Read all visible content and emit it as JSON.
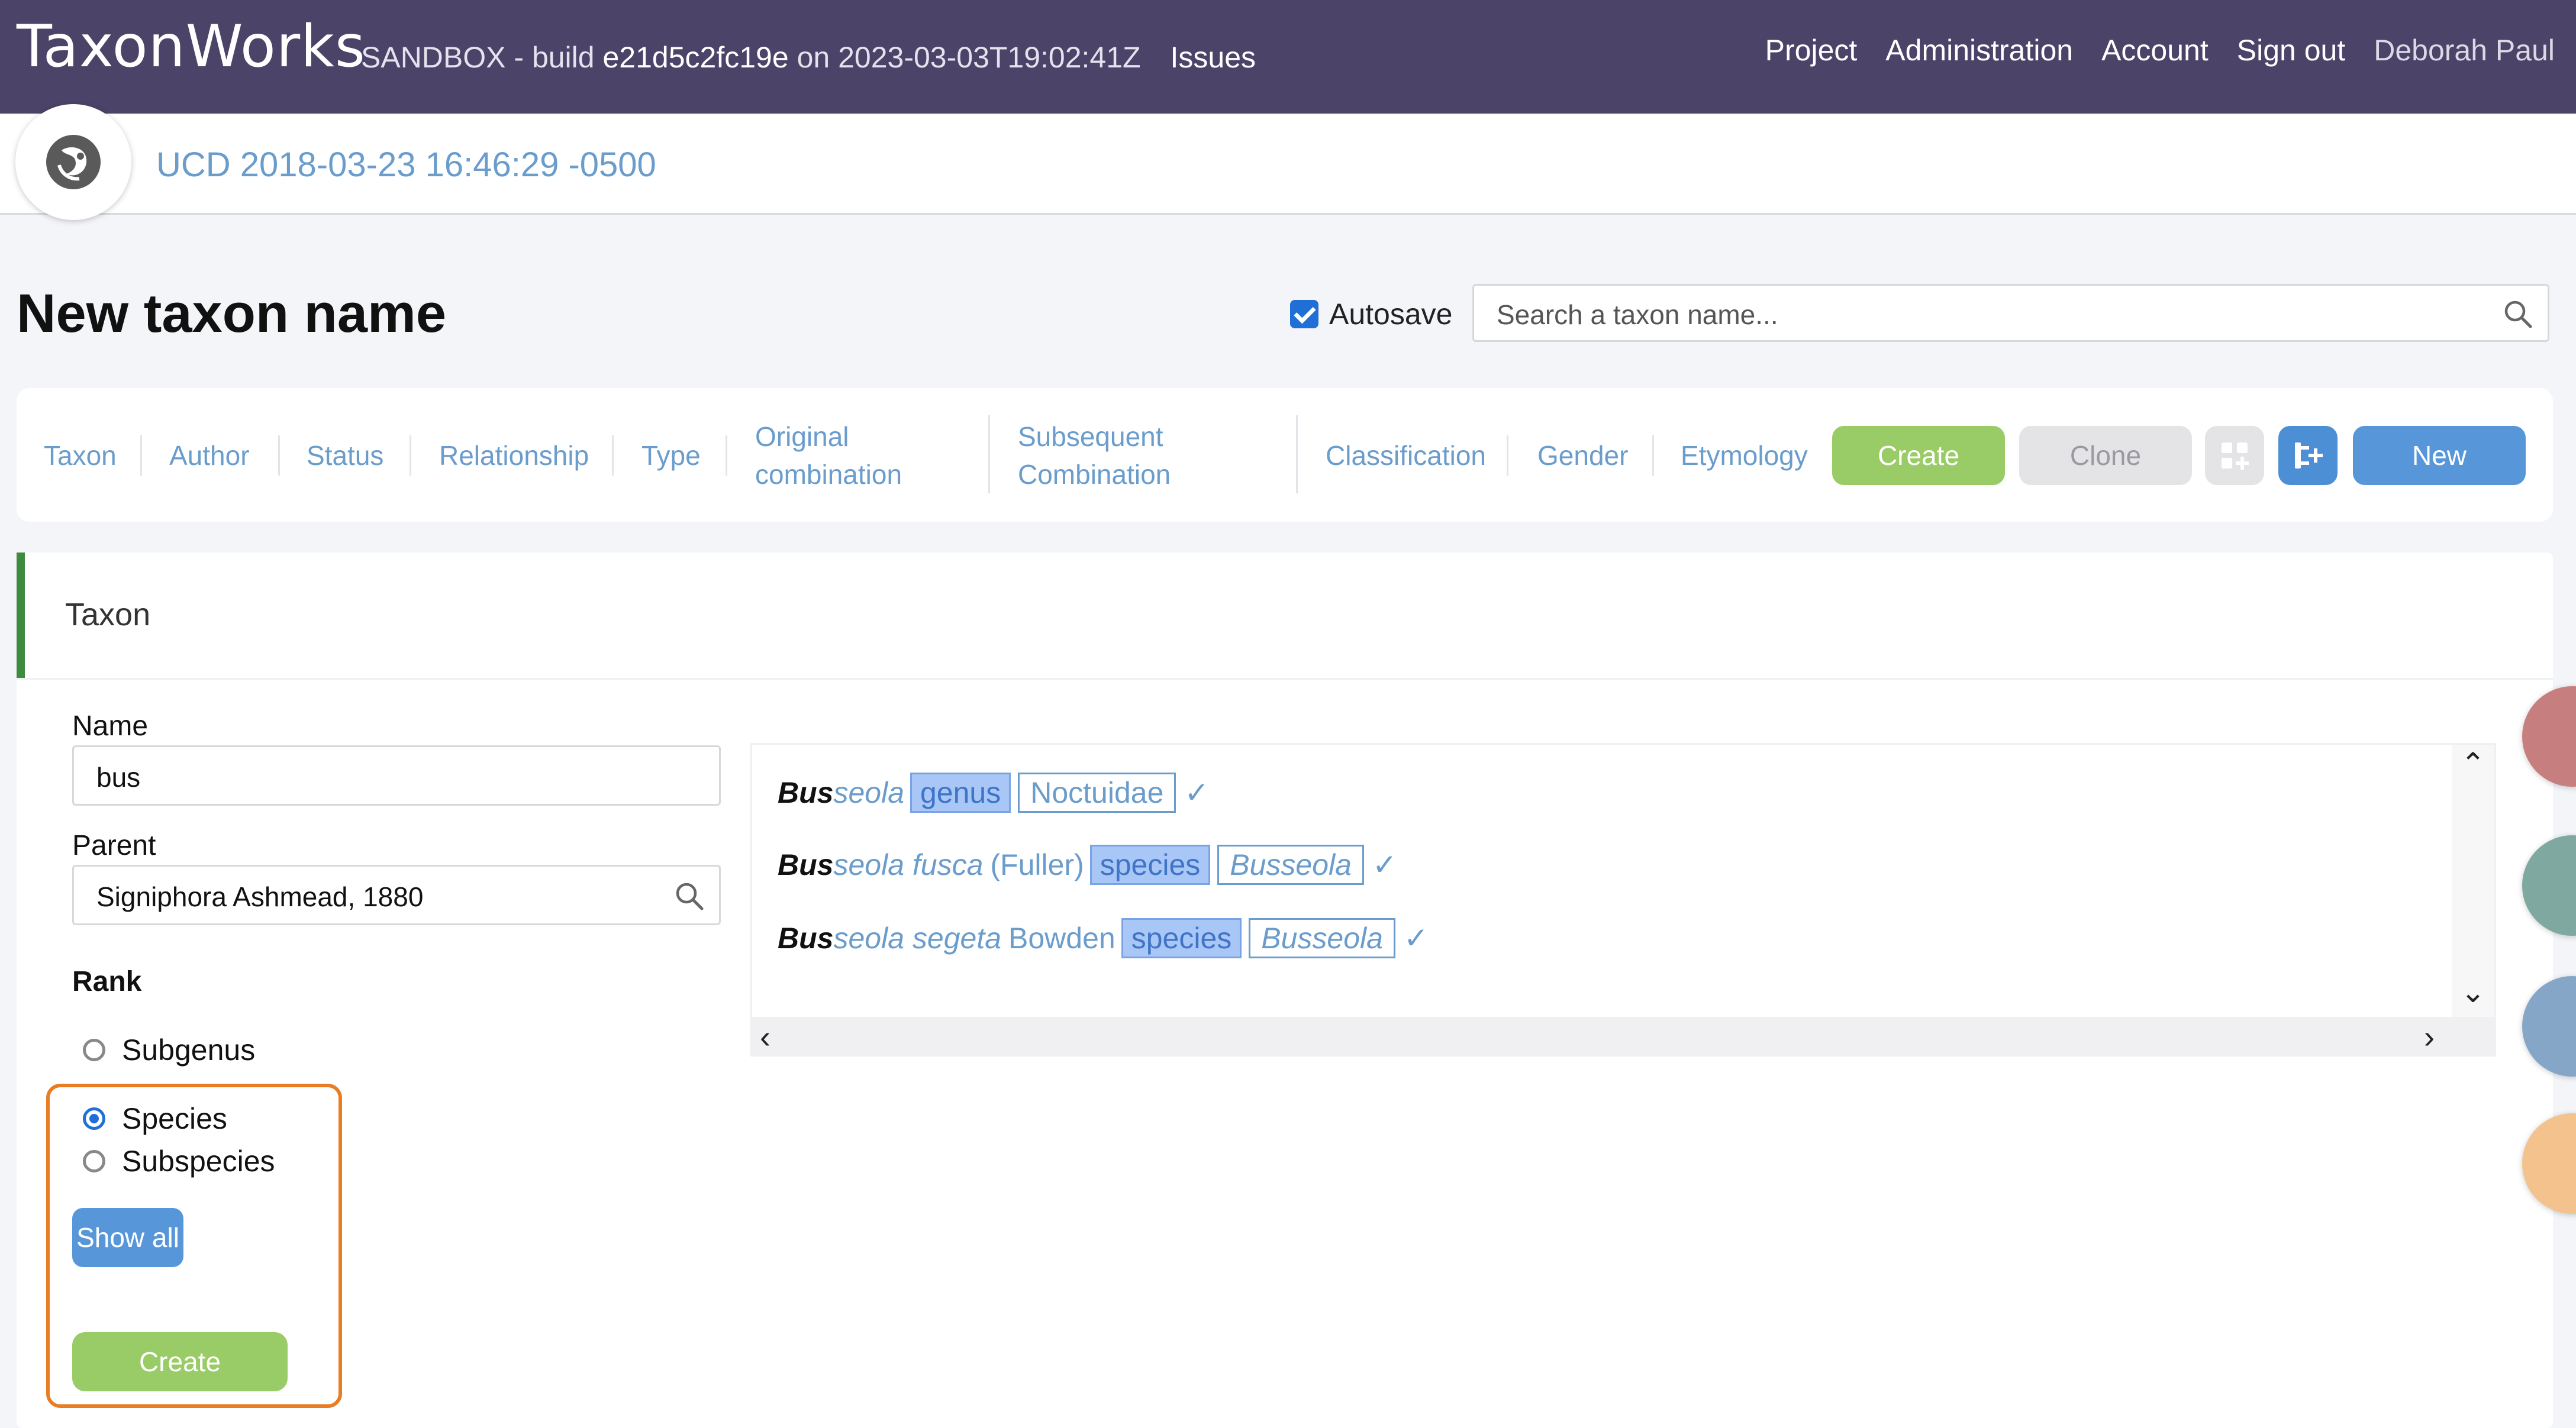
{
  "header": {
    "logo": "TaxonWorks",
    "build_prefix": "SANDBOX - build",
    "build_hash": "e21d5c2fc19e",
    "build_on": "on",
    "build_date": "2023-03-03T19:02:41Z",
    "issues": "Issues",
    "nav": [
      "Project",
      "Administration",
      "Account",
      "Sign out"
    ],
    "user": "Deborah Paul"
  },
  "project": {
    "name": "UCD 2018-03-23 16:46:29 -0500"
  },
  "page": {
    "title": "New taxon name",
    "autosave_label": "Autosave",
    "autosave_checked": true,
    "search_placeholder": "Search a taxon name..."
  },
  "tabs": {
    "taxon": "Taxon",
    "author": "Author",
    "status": "Status",
    "relationship": "Relationship",
    "type": "Type",
    "original_1": "Original",
    "original_2": "combination",
    "subsequent_1": "Subsequent",
    "subsequent_2": "Combination",
    "classification": "Classification",
    "gender": "Gender",
    "etymology": "Etymology"
  },
  "actions": {
    "create": "Create",
    "clone": "Clone",
    "new": "New"
  },
  "panel": {
    "title": "Taxon",
    "name_label": "Name",
    "name_value": "bus",
    "parent_label": "Parent",
    "parent_value": "Signiphora Ashmead, 1880",
    "rank_label": "Rank",
    "ranks": [
      {
        "label": "Subgenus",
        "selected": false
      },
      {
        "label": "Species",
        "selected": true
      },
      {
        "label": "Subspecies",
        "selected": false
      }
    ],
    "show_all": "Show all",
    "create": "Create"
  },
  "results": [
    {
      "match": "Bus",
      "rest": "seola",
      "author": "",
      "rank": "genus",
      "parent": "Noctuidae",
      "parent_italic": false,
      "tick": "✓"
    },
    {
      "match": "Bus",
      "rest": "seola fusca",
      "author": "(Fuller)",
      "rank": "species",
      "parent": "Busseola",
      "parent_italic": true,
      "tick": "✓"
    },
    {
      "match": "Bus",
      "rest": "seola segeta",
      "author": "Bowden",
      "rank": "species",
      "parent": "Busseola",
      "parent_italic": true,
      "tick": "✓"
    }
  ],
  "colors": {
    "topbar": "#4b4468",
    "link": "#6a9ccc",
    "create_green": "#99cb66",
    "primary_blue": "#5797d9",
    "highlight_orange": "#e87d24",
    "panel_accent": "#3e8a3e"
  }
}
